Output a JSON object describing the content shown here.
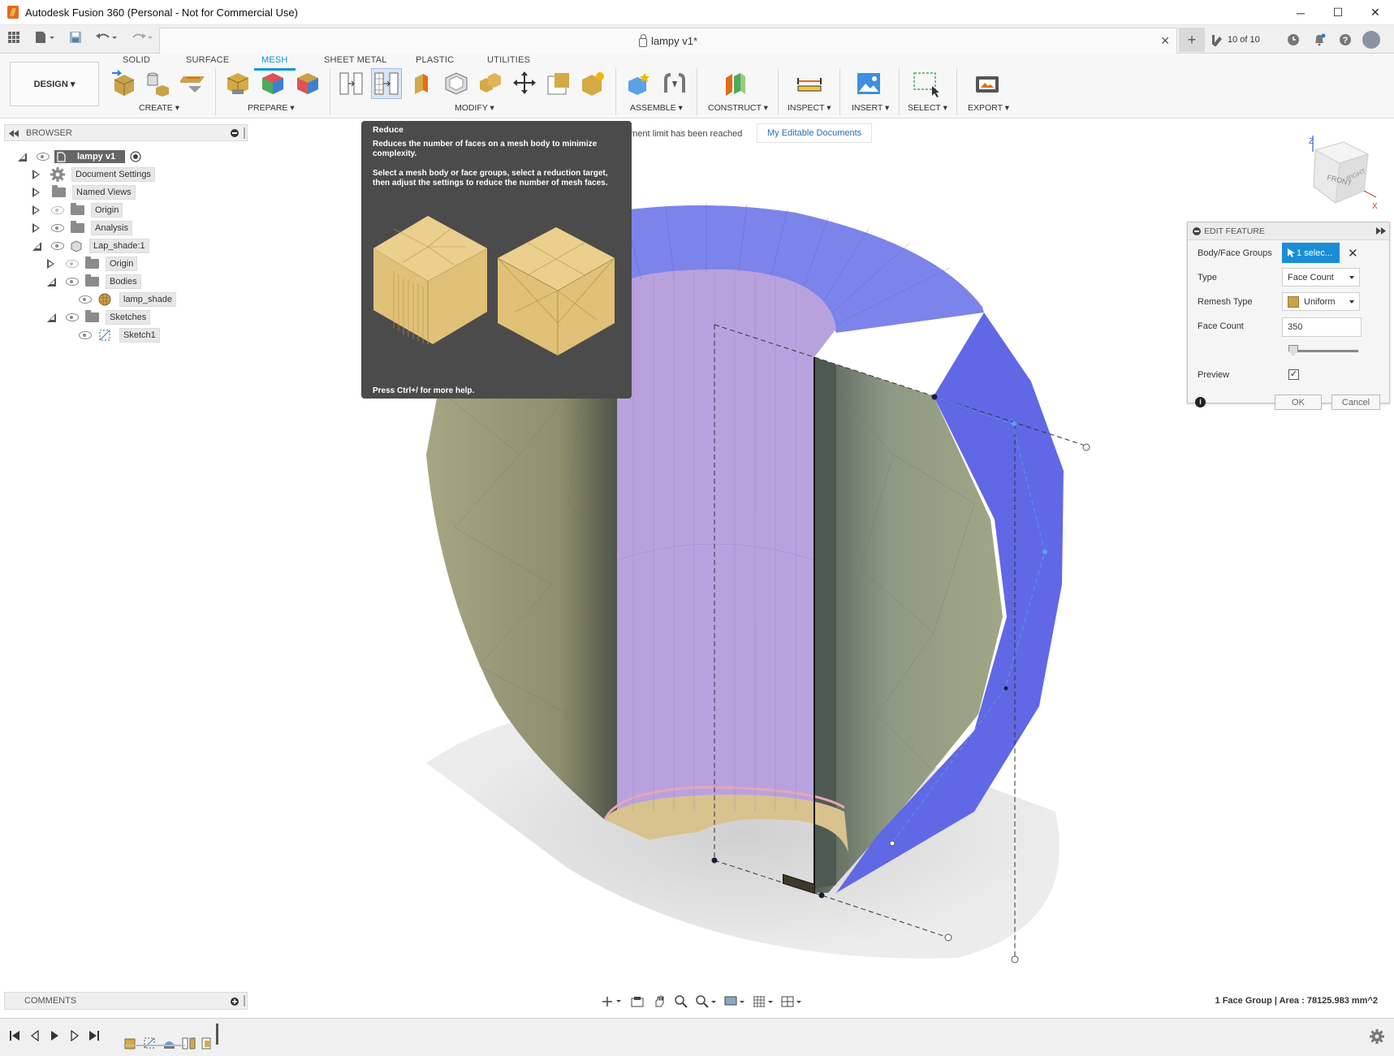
{
  "window": {
    "title": "Autodesk Fusion 360 (Personal - Not for Commercial Use)",
    "min": "─",
    "max": "☐",
    "close": "✕"
  },
  "doc_tab": {
    "title": "lampy v1*",
    "close": "✕"
  },
  "header_right": {
    "jobs": "10 of 10"
  },
  "toolbar": {
    "workspace_button": "DESIGN ▾",
    "tabs": [
      "SOLID",
      "SURFACE",
      "MESH",
      "SHEET METAL",
      "PLASTIC",
      "UTILITIES"
    ],
    "active_tab": "MESH",
    "groups": [
      "CREATE ▾",
      "PREPARE ▾",
      "MODIFY ▾",
      "ASSEMBLE ▾",
      "CONSTRUCT ▾",
      "INSPECT ▾",
      "INSERT ▾",
      "SELECT ▾",
      "EXPORT ▾"
    ]
  },
  "browser": {
    "title": "BROWSER",
    "root": "lampy v1",
    "items": [
      {
        "label": "Document Settings"
      },
      {
        "label": "Named Views"
      },
      {
        "label": "Origin"
      },
      {
        "label": "Analysis"
      },
      {
        "label": "Lap_shade:1"
      },
      {
        "label": "Origin"
      },
      {
        "label": "Bodies"
      },
      {
        "label": "lamp_shade"
      },
      {
        "label": "Sketches"
      },
      {
        "label": "Sketch1"
      }
    ]
  },
  "notice": {
    "text": "ument limit has been reached",
    "link": "My Editable Documents"
  },
  "tooltip": {
    "title": "Reduce",
    "description": "Reduces the number of faces on a mesh body to minimize complexity.",
    "instructions": "Select a mesh body or face groups, select a reduction target, then adjust the settings to reduce the number of mesh faces.",
    "help": "Press Ctrl+/ for more help."
  },
  "edit_feature": {
    "title": "EDIT FEATURE",
    "body_face_groups_label": "Body/Face Groups",
    "selection": "1 selec...",
    "type_label": "Type",
    "type_value": "Face Count",
    "remesh_type_label": "Remesh Type",
    "remesh_type_value": "Uniform",
    "face_count_label": "Face Count",
    "face_count_value": "350",
    "preview_label": "Preview",
    "preview_checked": "✓",
    "ok": "OK",
    "cancel": "Cancel",
    "info": "i"
  },
  "comments": {
    "title": "COMMENTS"
  },
  "status": {
    "text": "1 Face Group | Area : 78125.983 mm^2"
  },
  "viewcube": {
    "front": "FRONT",
    "right": "RIGHT",
    "z": "Z",
    "x": "X"
  },
  "colors": {
    "accent": "#0696d7",
    "mesh_blue": "#6b73e8",
    "mesh_purple": "#b39ad8",
    "mesh_olive": "#9c9d7a",
    "mesh_tan": "#d6c28a",
    "tooltip_bg": "#4b4b4b"
  }
}
